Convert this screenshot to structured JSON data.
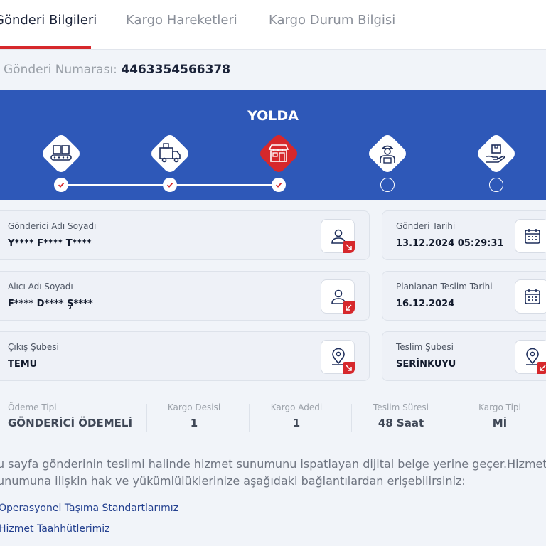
{
  "tabs": [
    {
      "label": "Gönderi Bilgileri",
      "active": true
    },
    {
      "label": "Kargo Hareketleri",
      "active": false
    },
    {
      "label": "Kargo Durum Bilgisi",
      "active": false
    }
  ],
  "shipment": {
    "label": "Gönderi Numarası:",
    "number": "4463354566378"
  },
  "status": {
    "title": "YOLDA",
    "steps": [
      {
        "icon": "conveyor-boxes-icon",
        "completed": true
      },
      {
        "icon": "delivery-truck-icon",
        "completed": true
      },
      {
        "icon": "branch-store-icon",
        "completed": true,
        "current": true
      },
      {
        "icon": "courier-icon",
        "completed": false
      },
      {
        "icon": "hand-package-icon",
        "completed": false
      }
    ]
  },
  "cards": {
    "sender": {
      "label": "Gönderici Adı Soyadı",
      "value": "Y**** F**** T****",
      "icon": "person-icon"
    },
    "send_date": {
      "label": "Gönderi Tarihi",
      "value": "13.12.2024 05:29:31",
      "icon": "calendar-icon"
    },
    "receiver": {
      "label": "Alıcı Adı Soyadı",
      "value": "F**** D**** Ş****",
      "icon": "person-icon"
    },
    "planned_date": {
      "label": "Planlanan Teslim Tarihi",
      "value": "16.12.2024",
      "icon": "calendar-icon"
    },
    "origin_branch": {
      "label": "Çıkış Şubesi",
      "value": "TEMU",
      "icon": "location-person-icon"
    },
    "delivery_branch": {
      "label": "Teslim Şubesi",
      "value": "SERİNKUYU",
      "icon": "location-person-icon"
    }
  },
  "summary": {
    "payment": {
      "label": "Ödeme Tipi",
      "value": "GÖNDERİCİ ÖDEMELİ"
    },
    "desi": {
      "label": "Kargo Desisi",
      "value": "1"
    },
    "count": {
      "label": "Kargo Adedi",
      "value": "1"
    },
    "duration": {
      "label": "Teslim Süresi",
      "value": "48 Saat"
    },
    "type": {
      "label": "Kargo Tipi",
      "value": "Mİ"
    }
  },
  "notice": {
    "line1": "u sayfa gönderinin teslimi halinde hizmet sunumunu ispatlayan dijital belge yerine geçer.Hizmet",
    "line2": "unumuna ilişkin hak ve yükümlülüklerinize aşağıdaki bağlantılardan erişebilirsiniz:"
  },
  "links": {
    "standards": "Operasyonel Taşıma Standartlarımız",
    "commitments": "Hizmet Taahhütlerimiz"
  },
  "colors": {
    "brand_blue": "#2e58b8",
    "brand_red": "#d6282c",
    "link": "#23408f"
  }
}
